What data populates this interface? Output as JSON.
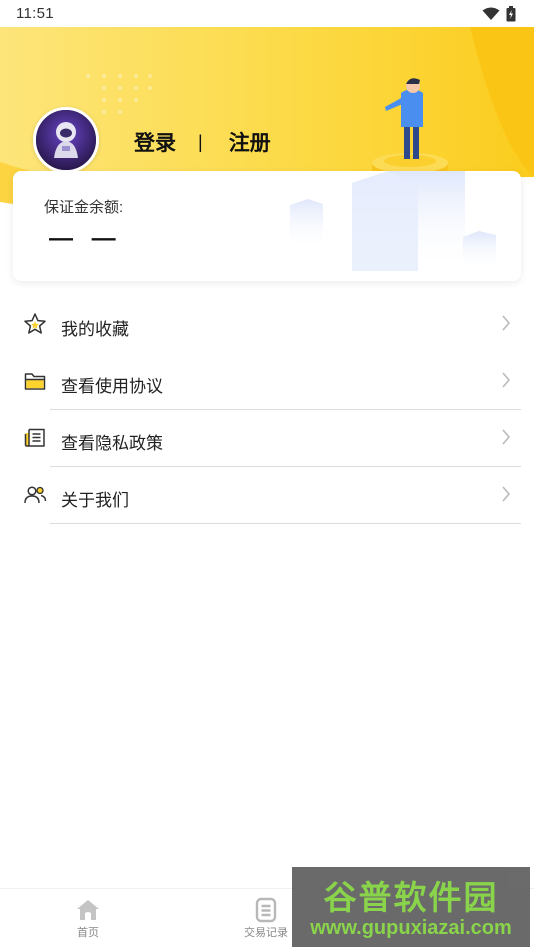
{
  "status_bar": {
    "time": "11:51"
  },
  "profile": {
    "login_label": "登录",
    "separator": "|",
    "register_label": "注册"
  },
  "balance": {
    "label": "保证金余额:",
    "value": "— —"
  },
  "menu": {
    "items": [
      {
        "label": "我的收藏",
        "icon": "star-icon"
      },
      {
        "label": "查看使用协议",
        "icon": "folder-icon"
      },
      {
        "label": "查看隐私政策",
        "icon": "document-icon"
      },
      {
        "label": "关于我们",
        "icon": "users-icon"
      }
    ]
  },
  "tab_bar": {
    "items": [
      {
        "label": "首页",
        "icon": "home-icon"
      },
      {
        "label": "交易记录",
        "icon": "list-icon"
      }
    ]
  },
  "watermark": {
    "title": "谷普软件园",
    "url": "www.gupuxiazai.com"
  },
  "colors": {
    "accent_yellow": "#fcd22e",
    "light_yellow": "#fde98f",
    "text_dark": "#222222",
    "watermark_green": "#7fd13b"
  }
}
